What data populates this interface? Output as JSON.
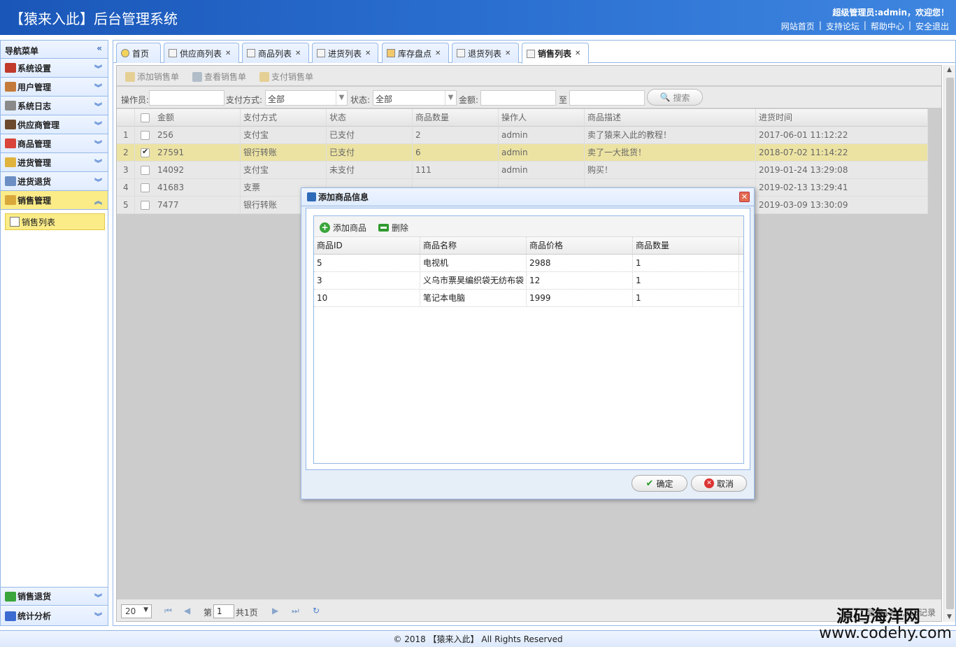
{
  "header": {
    "title": "【猿来入此】后台管理系统",
    "welcome": "超级管理员:admin，欢迎您！",
    "links": [
      "网站首页",
      "支持论坛",
      "帮助中心",
      "安全退出"
    ]
  },
  "nav": {
    "title": "导航菜单",
    "items": [
      "系统设置",
      "用户管理",
      "系统日志",
      "供应商管理",
      "商品管理",
      "进货管理",
      "进货退货",
      "销售管理"
    ],
    "sub": "销售列表",
    "bottom": [
      "销售退货",
      "统计分析"
    ]
  },
  "tabs": [
    "首页",
    "供应商列表",
    "商品列表",
    "进货列表",
    "库存盘点",
    "退货列表",
    "销售列表"
  ],
  "toolbar": {
    "add": "添加销售单",
    "view": "查看销售单",
    "pay": "支付销售单"
  },
  "filter": {
    "operator_label": "操作员:",
    "pay_label": "支付方式:",
    "pay_value": "全部",
    "status_label": "状态:",
    "status_value": "全部",
    "amount_label": "金额:",
    "to_label": "至",
    "search": "搜索"
  },
  "grid": {
    "headers": [
      "金额",
      "支付方式",
      "状态",
      "商品数量",
      "操作人",
      "商品描述",
      "进货时间"
    ],
    "rows": [
      {
        "n": "1",
        "amount": "256",
        "pay": "支付宝",
        "status": "已支付",
        "qty": "2",
        "op": "admin",
        "desc": "卖了猿来入此的教程！",
        "time": "2017-06-01 11:12:22"
      },
      {
        "n": "2",
        "amount": "27591",
        "pay": "银行转账",
        "status": "已支付",
        "qty": "6",
        "op": "admin",
        "desc": "卖了一大批货！",
        "time": "2018-07-02 11:14:22"
      },
      {
        "n": "3",
        "amount": "14092",
        "pay": "支付宝",
        "status": "未支付",
        "qty": "111",
        "op": "admin",
        "desc": "购买！",
        "time": "2019-01-24 13:29:08"
      },
      {
        "n": "4",
        "amount": "41683",
        "pay": "支票",
        "status": "",
        "qty": "",
        "op": "",
        "desc": "",
        "time": "2019-02-13 13:29:41"
      },
      {
        "n": "5",
        "amount": "7477",
        "pay": "银行转账",
        "status": "",
        "qty": "",
        "op": "",
        "desc": "",
        "time": "2019-03-09 13:30:09"
      }
    ]
  },
  "pager": {
    "size": "20",
    "page_label": "第",
    "page": "1",
    "total": "共1页",
    "records": "显示1到5,共5记录"
  },
  "dialog": {
    "title": "添加商品信息",
    "add": "添加商品",
    "del": "删除",
    "headers": [
      "商品ID",
      "商品名称",
      "商品价格",
      "商品数量"
    ],
    "rows": [
      {
        "id": "5",
        "name": "电视机",
        "price": "2988",
        "qty": "1"
      },
      {
        "id": "3",
        "name": "义乌市票昊编织袋无纺布袋",
        "price": "12",
        "qty": "1"
      },
      {
        "id": "10",
        "name": "笔记本电脑",
        "price": "1999",
        "qty": "1"
      }
    ],
    "ok": "确定",
    "cancel": "取消"
  },
  "footer": "© 2018 【猿来入此】 All Rights Reserved",
  "watermark": {
    "line1": "源码海洋网",
    "line2": "www.codehy.com"
  }
}
